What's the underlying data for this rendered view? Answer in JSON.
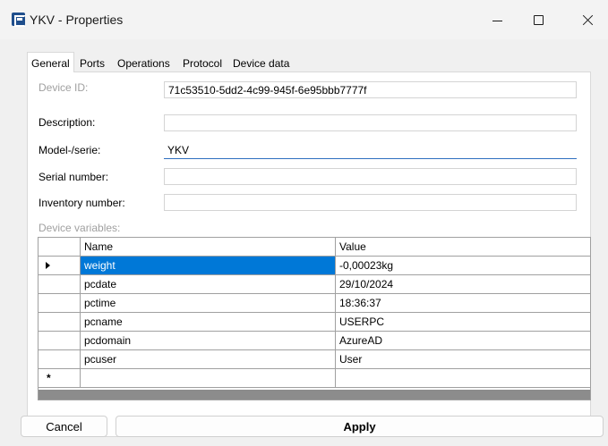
{
  "window": {
    "title": "YKV - Properties",
    "icon": "app-logo-icon",
    "controls": [
      "minimize-icon",
      "maximize-icon",
      "close-icon"
    ]
  },
  "tabs": [
    {
      "label": "General",
      "active": true
    },
    {
      "label": "Ports",
      "active": false
    },
    {
      "label": "Operations",
      "active": false
    },
    {
      "label": "Protocol",
      "active": false
    },
    {
      "label": "Device data",
      "active": false
    }
  ],
  "general": {
    "device_id": {
      "label": "Device ID:",
      "value": "71c53510-5dd2-4c99-945f-6e95bbb7777f"
    },
    "description": {
      "label": "Description:",
      "value": ""
    },
    "model": {
      "label": "Model-/serie:",
      "value": "YKV"
    },
    "serial": {
      "label": "Serial number:",
      "value": ""
    },
    "inventory": {
      "label": "Inventory number:",
      "value": ""
    },
    "variables_label": "Device variables:"
  },
  "grid": {
    "columns": [
      "Name",
      "Value"
    ],
    "rows": [
      {
        "name": "weight",
        "value": "-0,00023kg"
      },
      {
        "name": "pcdate",
        "value": "29/10/2024"
      },
      {
        "name": "pctime",
        "value": "18:36:37"
      },
      {
        "name": "pcname",
        "value": "USERPC"
      },
      {
        "name": "pcdomain",
        "value": "AzureAD"
      },
      {
        "name": "pcuser",
        "value": "User"
      }
    ],
    "new_row_marker": "*",
    "selection_color": "#0078d7"
  },
  "buttons": {
    "cancel": "Cancel",
    "apply": "Apply"
  }
}
